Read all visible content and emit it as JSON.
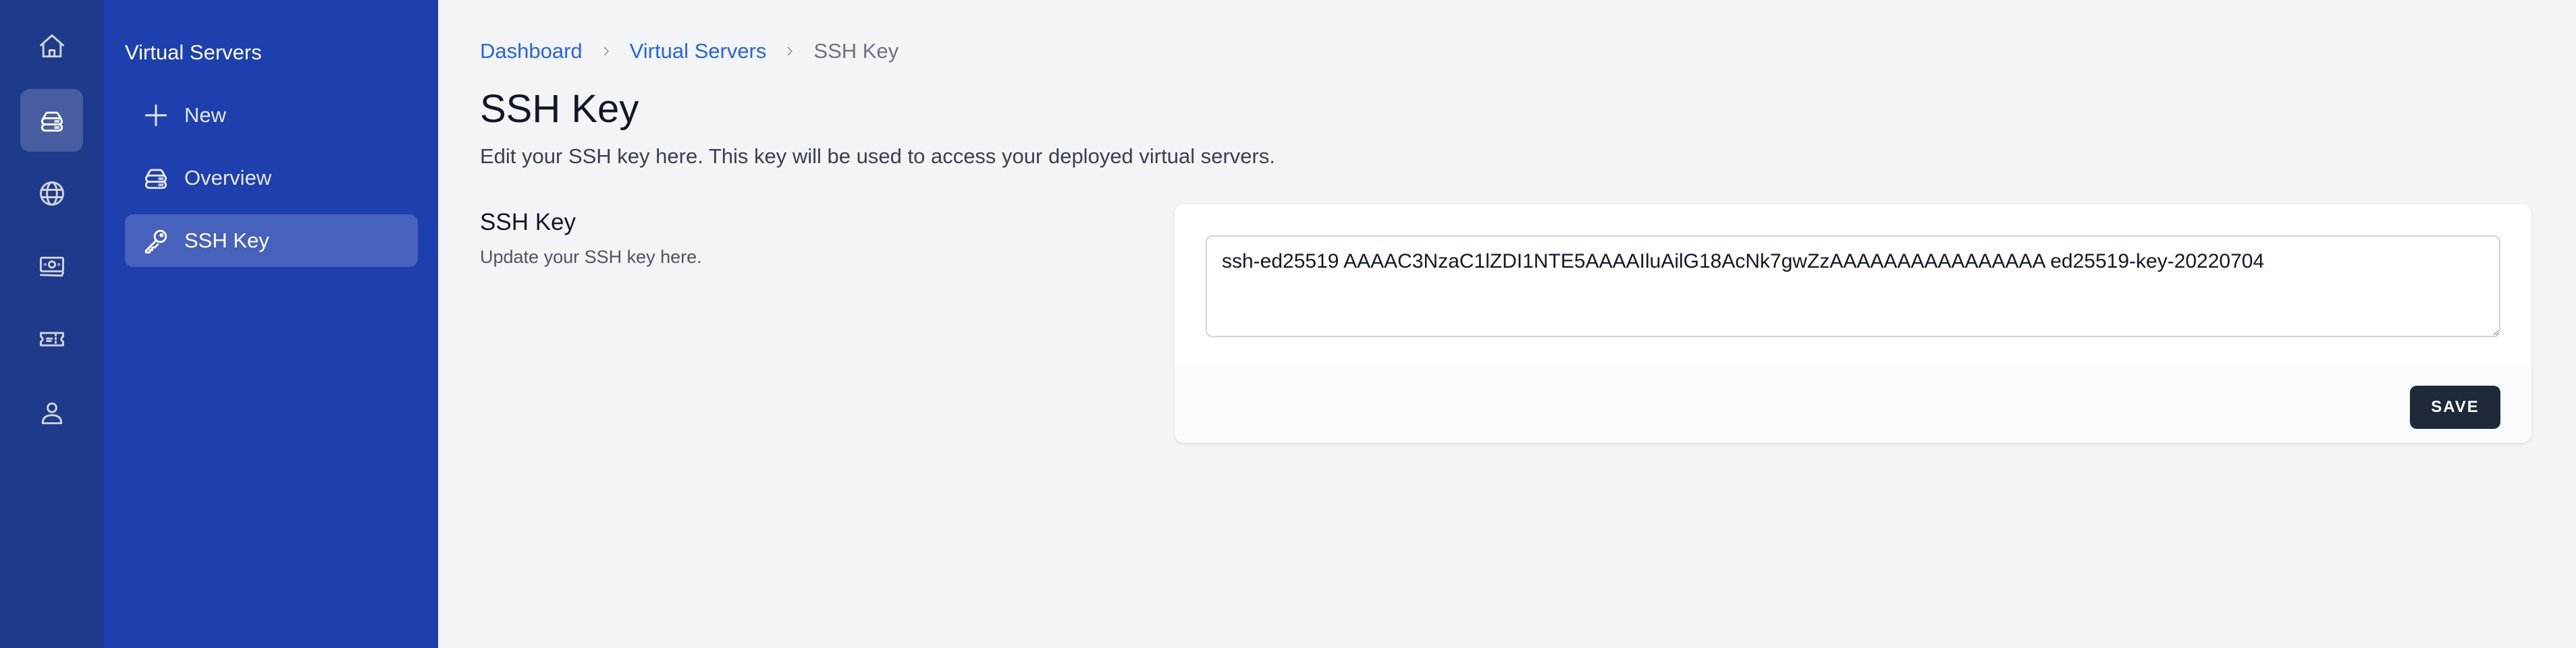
{
  "rail": {
    "items": [
      {
        "id": "home",
        "icon": "home-icon",
        "active": false
      },
      {
        "id": "virtual-servers",
        "icon": "server-icon",
        "active": true
      },
      {
        "id": "networking",
        "icon": "globe-icon",
        "active": false
      },
      {
        "id": "billing",
        "icon": "banknote-icon",
        "active": false
      },
      {
        "id": "tickets",
        "icon": "ticket-icon",
        "active": false
      },
      {
        "id": "account",
        "icon": "user-icon",
        "active": false
      }
    ]
  },
  "subnav": {
    "title": "Virtual Servers",
    "items": [
      {
        "label": "New",
        "icon": "plus-icon",
        "active": false
      },
      {
        "label": "Overview",
        "icon": "server-icon",
        "active": false
      },
      {
        "label": "SSH Key",
        "icon": "key-icon",
        "active": true
      }
    ]
  },
  "breadcrumb": {
    "items": [
      {
        "label": "Dashboard",
        "link": true
      },
      {
        "label": "Virtual Servers",
        "link": true
      },
      {
        "label": "SSH Key",
        "link": false
      }
    ],
    "separator_icon": "chevron-right-icon"
  },
  "page": {
    "title": "SSH Key",
    "description": "Edit your SSH key here. This key will be used to access your deployed virtual servers."
  },
  "section": {
    "title": "SSH Key",
    "description": "Update your SSH key here."
  },
  "form": {
    "ssh_key_value": "ssh-ed25519 AAAAC3NzaC1lZDI1NTE5AAAAIluAilG18AcNk7gwZzAAAAAAAAAAAAAAAA ed25519-key-20220704",
    "save_label": "SAVE"
  },
  "colors": {
    "rail_bg": "#1e3a8a",
    "subnav_bg": "#1e40af",
    "link": "#2563eb",
    "button_bg": "#1f2937",
    "page_bg": "#f3f4f6"
  }
}
